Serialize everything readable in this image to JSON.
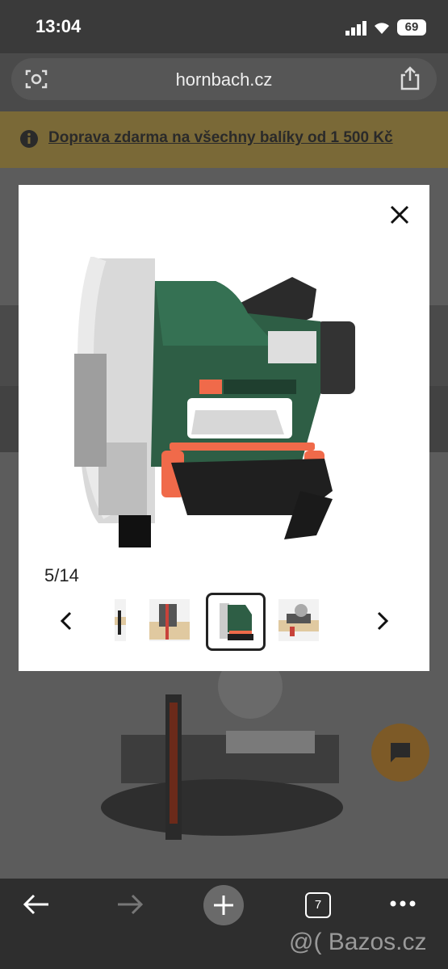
{
  "status_bar": {
    "time": "13:04",
    "battery": "69"
  },
  "browser": {
    "url": "hornbach.cz",
    "tab_count": "7"
  },
  "banner": {
    "text": "Doprava zdarma na všechny balíky od 1 500 Kč"
  },
  "gallery": {
    "counter": "5/14"
  },
  "watermark": {
    "text": "@( Bazos.cz"
  },
  "colors": {
    "brand_green": "#2e5e45",
    "accent_orange": "#f06a4a",
    "banner_bg": "#7a6937"
  },
  "icons": [
    "scan-icon",
    "share-icon",
    "info-icon",
    "close-icon",
    "chevron-left-icon",
    "chevron-right-icon",
    "chat-icon",
    "back-arrow-icon",
    "forward-arrow-icon",
    "plus-icon",
    "tabs-icon",
    "more-icon",
    "wifi-icon",
    "signal-icon",
    "battery-icon"
  ]
}
